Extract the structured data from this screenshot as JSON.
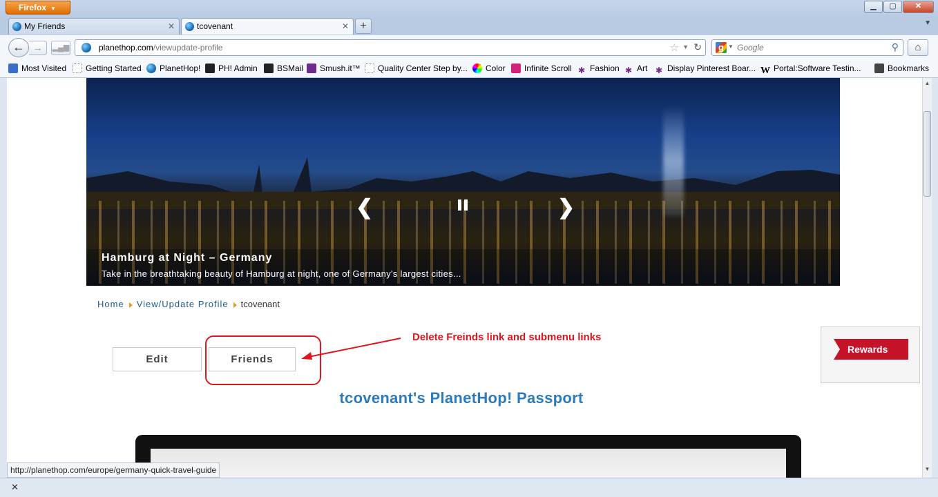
{
  "browser": {
    "menu_button": "Firefox",
    "window_controls": {
      "minimize": "▁",
      "maximize": "▢",
      "close": "✕"
    },
    "tabs": [
      {
        "label": "My Friends",
        "active": false
      },
      {
        "label": "tcovenant",
        "active": true
      }
    ],
    "new_tab": "+",
    "url_host": "planethop.com",
    "url_path": "/viewupdate-profile",
    "search_placeholder": "Google",
    "bookmarks": [
      {
        "label": "Most Visited",
        "icon": "most-visited-icon"
      },
      {
        "label": "Getting Started",
        "icon": "page-icon"
      },
      {
        "label": "PlanetHop!",
        "icon": "globe-icon"
      },
      {
        "label": "PH! Admin",
        "icon": "admin-icon"
      },
      {
        "label": "BSMail",
        "icon": "bsmail-icon"
      },
      {
        "label": "Smush.it™",
        "icon": "yahoo-icon"
      },
      {
        "label": "Quality Center Step by...",
        "icon": "page-icon"
      },
      {
        "label": "Color",
        "icon": "color-wheel-icon"
      },
      {
        "label": "Infinite Scroll",
        "icon": "d-icon"
      },
      {
        "label": "Fashion",
        "icon": "octopus-icon"
      },
      {
        "label": "Art",
        "icon": "octopus-icon"
      },
      {
        "label": "Display Pinterest Boar...",
        "icon": "octopus-icon"
      },
      {
        "label": "Portal:Software Testin...",
        "icon": "wikipedia-icon"
      }
    ],
    "bookmarks_menu": "Bookmarks",
    "status_url": "http://planethop.com/europe/germany-quick-travel-guide"
  },
  "page": {
    "slide": {
      "title": "Hamburg at Night – Germany",
      "text": "Take in the breathtaking beauty of Hamburg at night, one of Germany's largest cities..."
    },
    "breadcrumb": {
      "home": "Home",
      "profile": "View/Update Profile",
      "current": "tcovenant"
    },
    "buttons": {
      "edit": "Edit",
      "friends": "Friends"
    },
    "annotation": "Delete Freinds link and submenu links",
    "rewards": "Rewards",
    "passport_title": "tcovenant's PlanetHop! Passport"
  },
  "colors": {
    "accent_blue": "#2c7bbd",
    "annotation_red": "#e0141c",
    "rewards_red": "#c5132a",
    "breadcrumb_arrow": "#e39b1c"
  }
}
